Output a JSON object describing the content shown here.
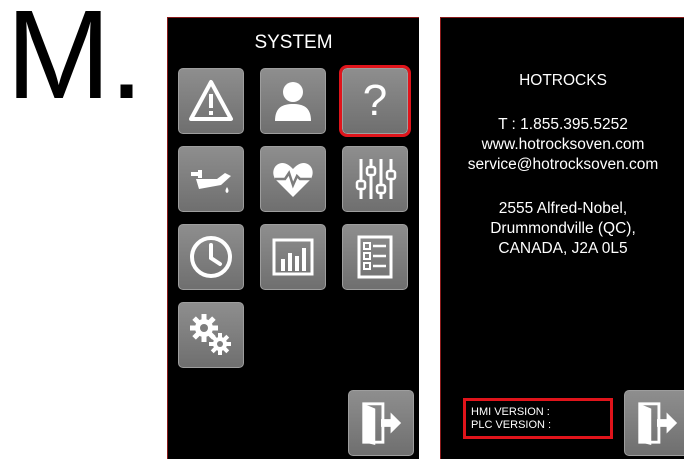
{
  "step_label": "M.",
  "system_screen": {
    "title": "SYSTEM",
    "tiles": [
      {
        "name": "alarm-tile",
        "icon": "warning-icon"
      },
      {
        "name": "user-tile",
        "icon": "user-icon"
      },
      {
        "name": "help-tile",
        "icon": "help-icon",
        "glyph": "?",
        "selected": true
      },
      {
        "name": "oil-tile",
        "icon": "oil-can-icon"
      },
      {
        "name": "health-tile",
        "icon": "heart-pulse-icon"
      },
      {
        "name": "adjust-tile",
        "icon": "sliders-icon"
      },
      {
        "name": "clock-tile",
        "icon": "clock-icon"
      },
      {
        "name": "statistics-tile",
        "icon": "bar-chart-icon"
      },
      {
        "name": "checklist-tile",
        "icon": "checklist-icon"
      },
      {
        "name": "settings-tile",
        "icon": "gears-icon"
      }
    ],
    "exit_icon": "exit-icon"
  },
  "help_screen": {
    "company": "HOTROCKS",
    "phone": "T : 1.855.395.5252",
    "website": "www.hotrocksoven.com",
    "email": "service@hotrocksoven.com",
    "address_line1": "2555 Alfred-Nobel,",
    "address_line2": "Drummondville (QC),",
    "address_line3": "CANADA, J2A 0L5",
    "hmi_version_label": "HMI VERSION :",
    "plc_version_label": "PLC VERSION :",
    "exit_icon": "exit-icon"
  },
  "colors": {
    "screen_bg": "#000000",
    "tile_gray": "#7d7d7d",
    "highlight_red": "#e0141b",
    "text": "#ffffff"
  }
}
